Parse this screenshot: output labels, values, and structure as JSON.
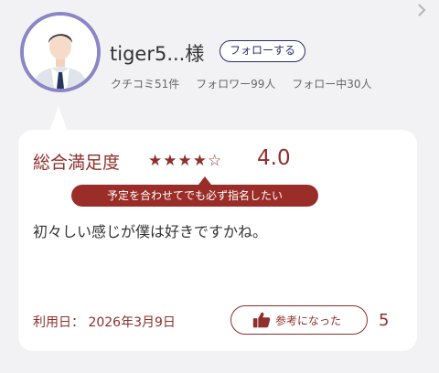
{
  "profile": {
    "username": "tiger5...様",
    "follow_label": "フォローする",
    "stats": {
      "reviews": "クチコミ51件",
      "followers": "フォロワー99人",
      "following": "フォロー中30人"
    },
    "avatar_icon": "person-avatar-icon"
  },
  "nav": {
    "icon": "chevron-right-icon"
  },
  "review": {
    "rating_label": "総合満足度",
    "stars": "★★★★",
    "stars_empty": "☆",
    "rating_value": 4,
    "score": "4.0",
    "tag": "予定を合わせてでも必ず指名したい",
    "text": "初々しい感じが僕は好きですかね。",
    "date_label": "利用日：",
    "date_value": "2026年3月9日",
    "helpful_label": "参考になった",
    "helpful_count": "5",
    "helpful_icon": "thumbs-up-icon"
  },
  "colors": {
    "accent": "#8f2f2a",
    "tag_bg": "#9b2d28",
    "follow_border": "#2b2b6b",
    "avatar_ring": "#8c85c6",
    "page_bg": "#f2f2f4"
  }
}
